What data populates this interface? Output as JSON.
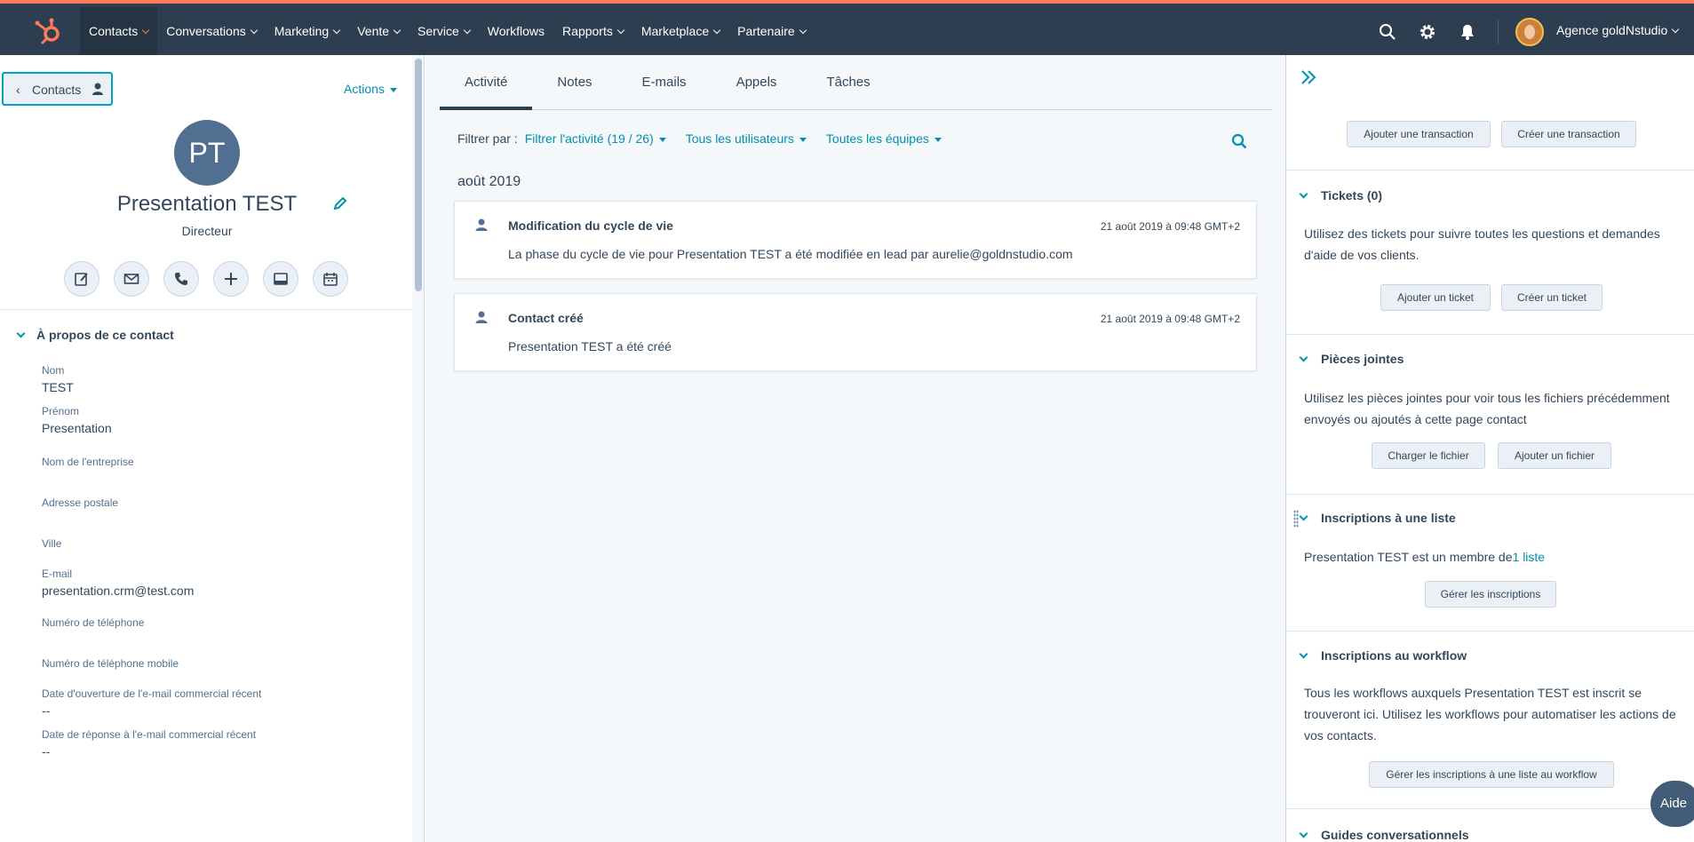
{
  "nav": {
    "items": [
      {
        "label": "Contacts",
        "dropdown": true,
        "active": true
      },
      {
        "label": "Conversations",
        "dropdown": true
      },
      {
        "label": "Marketing",
        "dropdown": true
      },
      {
        "label": "Vente",
        "dropdown": true
      },
      {
        "label": "Service",
        "dropdown": true
      },
      {
        "label": "Workflows",
        "dropdown": false
      },
      {
        "label": "Rapports",
        "dropdown": true
      },
      {
        "label": "Marketplace",
        "dropdown": true
      },
      {
        "label": "Partenaire",
        "dropdown": true
      }
    ],
    "account_name": "Agence goldNstudio",
    "accent": "#ff7a59"
  },
  "contact": {
    "back_label": "Contacts",
    "actions_label": "Actions",
    "initials": "PT",
    "name": "Presentation TEST",
    "job_title": "Directeur",
    "about_title": "À propos de ce contact",
    "properties": [
      {
        "label": "Nom",
        "value": "TEST"
      },
      {
        "label": "Prénom",
        "value": "Presentation"
      },
      {
        "label": "Nom de l'entreprise",
        "value": ""
      },
      {
        "label": "Adresse postale",
        "value": ""
      },
      {
        "label": "Ville",
        "value": ""
      },
      {
        "label": "E-mail",
        "value": "presentation.crm@test.com"
      },
      {
        "label": "Numéro de téléphone",
        "value": ""
      },
      {
        "label": "Numéro de téléphone mobile",
        "value": ""
      },
      {
        "label": "Date d'ouverture de l'e-mail commercial récent",
        "value": "--"
      },
      {
        "label": "Date de réponse à l'e-mail commercial récent",
        "value": "--"
      }
    ]
  },
  "activity": {
    "tabs": [
      "Activité",
      "Notes",
      "E-mails",
      "Appels",
      "Tâches"
    ],
    "filter_label": "Filtrer par :",
    "filter_activity": "Filtrer l'activité (19 / 26)",
    "filter_users": "Tous les utilisateurs",
    "filter_teams": "Toutes les équipes",
    "month": "août 2019",
    "events": [
      {
        "title": "Modification du cycle de vie",
        "time": "21 août 2019 à 09:48 GMT+2",
        "body": "La phase du cycle de vie pour Presentation TEST a été modifiée en lead par aurelie@goldnstudio.com"
      },
      {
        "title": "Contact créé",
        "time": "21 août 2019 à 09:48 GMT+2",
        "body": "Presentation TEST a été créé"
      }
    ]
  },
  "sidebar": {
    "deals": {
      "add": "Ajouter une transaction",
      "create": "Créer une transaction"
    },
    "tickets": {
      "title": "Tickets (0)",
      "text": "Utilisez des tickets pour suivre toutes les questions et demandes d'aide de vos clients.",
      "add": "Ajouter un ticket",
      "create": "Créer un ticket"
    },
    "attachments": {
      "title": "Pièces jointes",
      "text": "Utilisez les pièces jointes pour voir tous les fichiers précédemment envoyés ou ajoutés à cette page contact",
      "upload": "Charger le fichier",
      "add": "Ajouter un fichier"
    },
    "lists": {
      "title": "Inscriptions à une liste",
      "name": "Presentation TEST",
      "member_text": " est un membre de",
      "link": "1 liste",
      "manage": "Gérer les inscriptions"
    },
    "workflows": {
      "title": "Inscriptions au workflow",
      "text": "Tous les workflows auxquels Presentation TEST est inscrit se trouveront ici. Utilisez les workflows pour automatiser les actions de vos contacts.",
      "manage": "Gérer les inscriptions à une liste au workflow"
    },
    "guides": {
      "title": "Guides conversationnels"
    }
  },
  "help_label": "Aide"
}
